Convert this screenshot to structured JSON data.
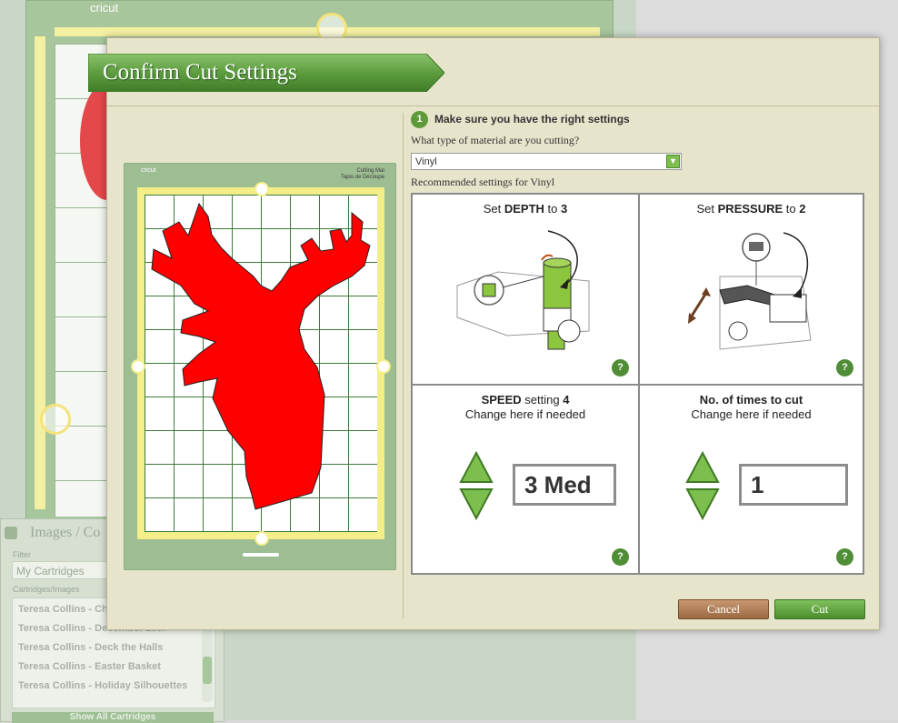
{
  "background": {
    "mat_logo": "cricut",
    "panel": {
      "title": "Images / Co",
      "filter_label": "Filter",
      "filter_value": "My Cartridges",
      "list_label": "Cartridges/Images",
      "items": [
        "Teresa Collins - Ch",
        "Teresa Collins - December 25th",
        "Teresa Collins - Deck the Halls",
        "Teresa Collins - Easter Basket",
        "Teresa Collins - Holiday Silhouettes"
      ],
      "show_all": "Show All Cartridges"
    }
  },
  "dialog": {
    "title": "Confirm Cut Settings",
    "mat": {
      "logo": "cricut",
      "title_line1": "Cutting Mat",
      "title_line2": "Tapis de Découpe"
    },
    "step_number": "1",
    "step_text": "Make sure you have the right settings",
    "material_question": "What type of material are you cutting?",
    "material_value": "Vinyl",
    "recommended": "Recommended settings for Vinyl",
    "depth": {
      "prefix": "Set ",
      "label": "DEPTH",
      "mid": " to ",
      "value": "3"
    },
    "pressure": {
      "prefix": "Set ",
      "label": "PRESSURE",
      "mid": " to ",
      "value": "2"
    },
    "speed": {
      "label": "SPEED",
      "mid": " setting ",
      "value": "4",
      "sub": "Change here if needed",
      "current": "3 Med"
    },
    "times": {
      "label": "No. of times to cut",
      "sub": "Change here if needed",
      "current": "1"
    },
    "help": "?",
    "cancel_label": "Cancel",
    "cut_label": "Cut"
  },
  "colors": {
    "accent_green": "#5c9a3a",
    "cancel_brown": "#a87450",
    "dialog_bg": "#e7e4cc",
    "deer_red": "#ff0000"
  }
}
